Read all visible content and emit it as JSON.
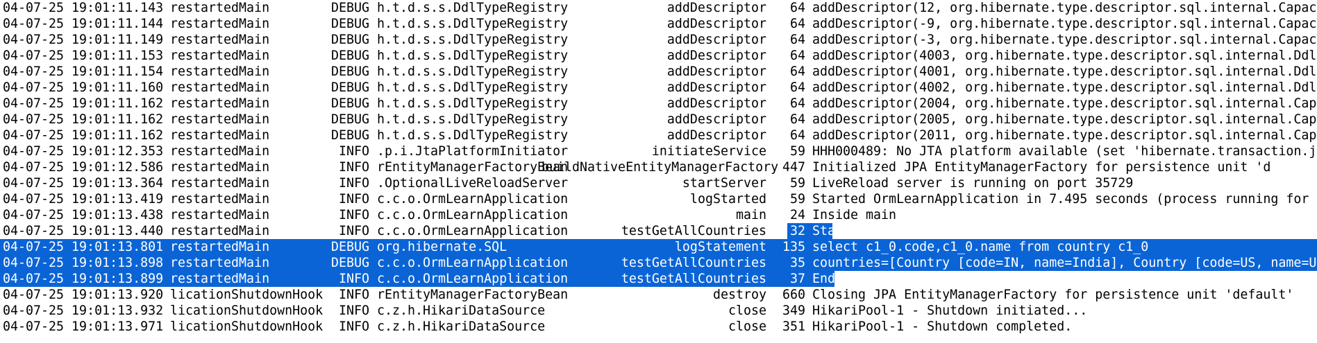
{
  "console": {
    "selection_color": "#0a64d6",
    "rows": [
      {
        "date": "04-07-25 19:01:11.143",
        "thread": "restartedMain",
        "level": "DEBUG",
        "logger": "h.t.d.s.s.DdlTypeRegistry",
        "method": "addDescriptor",
        "line": "64",
        "message": "addDescriptor(12, org.hibernate.type.descriptor.sql.internal.Capac",
        "selected": "none"
      },
      {
        "date": "04-07-25 19:01:11.144",
        "thread": "restartedMain",
        "level": "DEBUG",
        "logger": "h.t.d.s.s.DdlTypeRegistry",
        "method": "addDescriptor",
        "line": "64",
        "message": "addDescriptor(-9, org.hibernate.type.descriptor.sql.internal.Capac",
        "selected": "none"
      },
      {
        "date": "04-07-25 19:01:11.149",
        "thread": "restartedMain",
        "level": "DEBUG",
        "logger": "h.t.d.s.s.DdlTypeRegistry",
        "method": "addDescriptor",
        "line": "64",
        "message": "addDescriptor(-3, org.hibernate.type.descriptor.sql.internal.Capac",
        "selected": "none"
      },
      {
        "date": "04-07-25 19:01:11.153",
        "thread": "restartedMain",
        "level": "DEBUG",
        "logger": "h.t.d.s.s.DdlTypeRegistry",
        "method": "addDescriptor",
        "line": "64",
        "message": "addDescriptor(4003, org.hibernate.type.descriptor.sql.internal.Ddl",
        "selected": "none"
      },
      {
        "date": "04-07-25 19:01:11.154",
        "thread": "restartedMain",
        "level": "DEBUG",
        "logger": "h.t.d.s.s.DdlTypeRegistry",
        "method": "addDescriptor",
        "line": "64",
        "message": "addDescriptor(4001, org.hibernate.type.descriptor.sql.internal.Ddl",
        "selected": "none"
      },
      {
        "date": "04-07-25 19:01:11.160",
        "thread": "restartedMain",
        "level": "DEBUG",
        "logger": "h.t.d.s.s.DdlTypeRegistry",
        "method": "addDescriptor",
        "line": "64",
        "message": "addDescriptor(4002, org.hibernate.type.descriptor.sql.internal.Ddl",
        "selected": "none"
      },
      {
        "date": "04-07-25 19:01:11.162",
        "thread": "restartedMain",
        "level": "DEBUG",
        "logger": "h.t.d.s.s.DdlTypeRegistry",
        "method": "addDescriptor",
        "line": "64",
        "message": "addDescriptor(2004, org.hibernate.type.descriptor.sql.internal.Cap",
        "selected": "none"
      },
      {
        "date": "04-07-25 19:01:11.162",
        "thread": "restartedMain",
        "level": "DEBUG",
        "logger": "h.t.d.s.s.DdlTypeRegistry",
        "method": "addDescriptor",
        "line": "64",
        "message": "addDescriptor(2005, org.hibernate.type.descriptor.sql.internal.Cap",
        "selected": "none"
      },
      {
        "date": "04-07-25 19:01:11.162",
        "thread": "restartedMain",
        "level": "DEBUG",
        "logger": "h.t.d.s.s.DdlTypeRegistry",
        "method": "addDescriptor",
        "line": "64",
        "message": "addDescriptor(2011, org.hibernate.type.descriptor.sql.internal.Cap",
        "selected": "none"
      },
      {
        "date": "04-07-25 19:01:12.353",
        "thread": "restartedMain",
        "level": "INFO",
        "logger": ".p.i.JtaPlatformInitiator",
        "method": "initiateService",
        "line": "59",
        "message": "HHH000489: No JTA platform available (set 'hibernate.transaction.j",
        "selected": "none"
      },
      {
        "date": "04-07-25 19:01:12.586",
        "thread": "restartedMain",
        "level": "INFO",
        "logger": "rEntityManagerFactoryBean",
        "method": "buildNativeEntityManagerFactory",
        "line": "447",
        "message": "Initialized JPA EntityManagerFactory for persistence unit 'd",
        "selected": "none"
      },
      {
        "date": "04-07-25 19:01:13.364",
        "thread": "restartedMain",
        "level": "INFO",
        "logger": ".OptionalLiveReloadServer",
        "method": "startServer",
        "line": "59",
        "message": "LiveReload server is running on port 35729",
        "selected": "none"
      },
      {
        "date": "04-07-25 19:01:13.419",
        "thread": "restartedMain",
        "level": "INFO",
        "logger": "c.c.o.OrmLearnApplication",
        "method": "logStarted",
        "line": "59",
        "message": "Started OrmLearnApplication in 7.495 seconds (process running for",
        "selected": "none"
      },
      {
        "date": "04-07-25 19:01:13.438",
        "thread": "restartedMain",
        "level": "INFO",
        "logger": "c.c.o.OrmLearnApplication",
        "method": "main",
        "line": "24",
        "message": "Inside main",
        "selected": "none"
      },
      {
        "date": "04-07-25 19:01:13.440",
        "thread": "restartedMain",
        "level": "INFO",
        "logger": "c.c.o.OrmLearnApplication",
        "method": "testGetAllCountries",
        "line": "32",
        "message": "Start",
        "selected": "partial"
      },
      {
        "date": "04-07-25 19:01:13.801",
        "thread": "restartedMain",
        "level": "DEBUG",
        "logger": "org.hibernate.SQL",
        "method": "logStatement",
        "line": "135",
        "message": "select c1_0.code,c1_0.name from country c1_0",
        "selected": "full"
      },
      {
        "date": "04-07-25 19:01:13.898",
        "thread": "restartedMain",
        "level": "DEBUG",
        "logger": "c.c.o.OrmLearnApplication",
        "method": "testGetAllCountries",
        "line": "35",
        "message": "countries=[Country [code=IN, name=India], Country [code=US, name=U",
        "selected": "full"
      },
      {
        "date": "04-07-25 19:01:13.899",
        "thread": "restartedMain",
        "level": "INFO",
        "logger": "c.c.o.OrmLearnApplication",
        "method": "testGetAllCountries",
        "line": "37",
        "message": "End",
        "selected": "end"
      },
      {
        "date": "04-07-25 19:01:13.920",
        "thread": "licationShutdownHook",
        "level": "INFO",
        "logger": "rEntityManagerFactoryBean",
        "method": "destroy",
        "line": "660",
        "message": "Closing JPA EntityManagerFactory for persistence unit 'default'",
        "selected": "none"
      },
      {
        "date": "04-07-25 19:01:13.932",
        "thread": "licationShutdownHook",
        "level": "INFO",
        "logger": "c.z.h.HikariDataSource",
        "method": "close",
        "line": "349",
        "message": "HikariPool-1 - Shutdown initiated...",
        "selected": "none"
      },
      {
        "date": "04-07-25 19:01:13.971",
        "thread": "licationShutdownHook",
        "level": "INFO",
        "logger": "c.z.h.HikariDataSource",
        "method": "close",
        "line": "351",
        "message": "HikariPool-1 - Shutdown completed.",
        "selected": "none"
      }
    ]
  }
}
